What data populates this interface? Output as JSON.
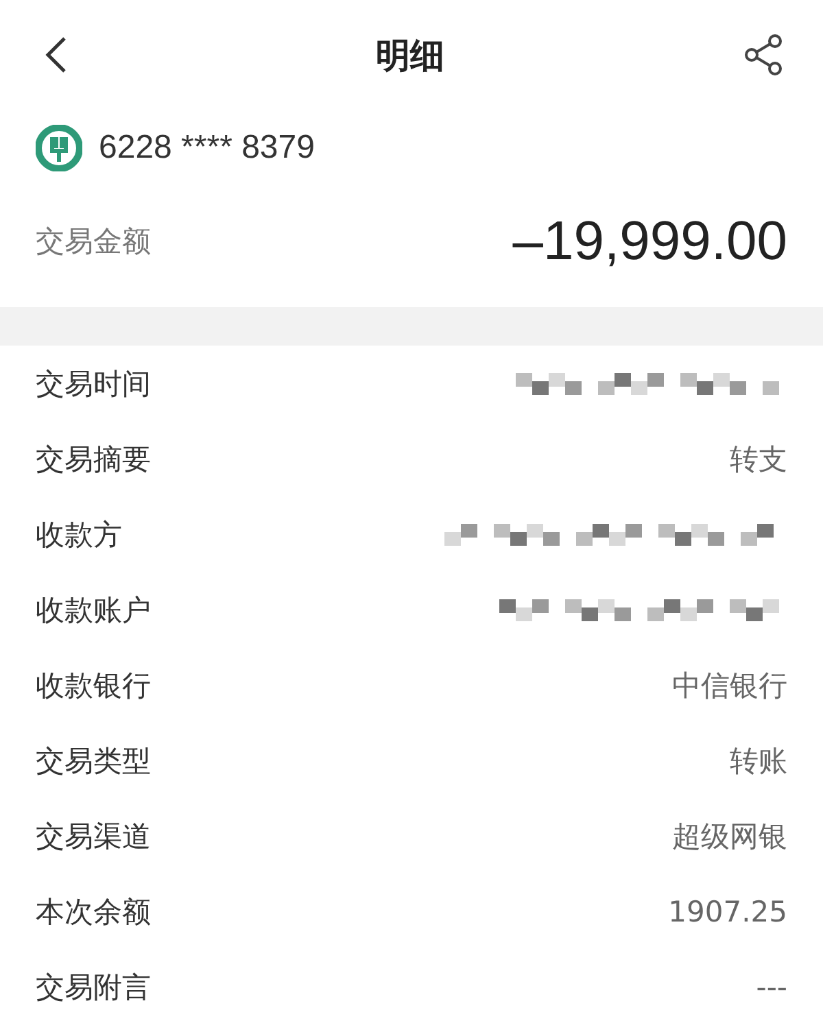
{
  "header": {
    "title": "明细"
  },
  "account": {
    "card_number": "6228 **** 8379",
    "amount_label": "交易金额",
    "amount": "–19,999.00"
  },
  "details": [
    {
      "label": "交易时间",
      "kind": "redacted"
    },
    {
      "label": "交易摘要",
      "kind": "text",
      "value": "转支"
    },
    {
      "label": "收款方",
      "kind": "redacted"
    },
    {
      "label": "收款账户",
      "kind": "redacted"
    },
    {
      "label": "收款银行",
      "kind": "text",
      "value": "中信银行"
    },
    {
      "label": "交易类型",
      "kind": "text",
      "value": "转账"
    },
    {
      "label": "交易渠道",
      "kind": "text",
      "value": "超级网银"
    },
    {
      "label": "本次余额",
      "kind": "text",
      "value": "1907.25"
    },
    {
      "label": "交易附言",
      "kind": "text",
      "value": "---"
    }
  ]
}
